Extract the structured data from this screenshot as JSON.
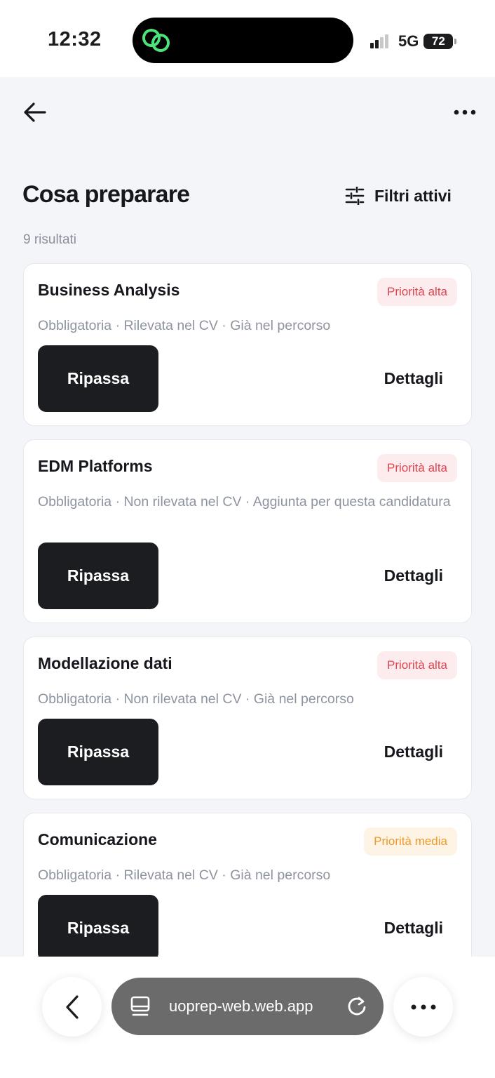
{
  "status_bar": {
    "time": "12:32",
    "network": "5G",
    "battery": "72"
  },
  "header": {
    "title": "Cosa preparare",
    "filters_label": "Filtri attivi",
    "result_count": "9 risultati"
  },
  "cards": [
    {
      "title": "Business Analysis",
      "priority": "Priorità alta",
      "meta": "Obbligatoria · Rilevata nel CV · Già nel percorso",
      "review_label": "Ripassa",
      "details_label": "Dettagli"
    },
    {
      "title": "EDM Platforms",
      "priority": "Priorità alta",
      "meta": "Obbligatoria · Non rilevata nel CV · Aggiunta per questa candidatura",
      "review_label": "Ripassa",
      "details_label": "Dettagli"
    },
    {
      "title": "Modellazione dati",
      "priority": "Priorità alta",
      "meta": "Obbligatoria · Non rilevata nel CV · Già nel percorso",
      "review_label": "Ripassa",
      "details_label": "Dettagli"
    },
    {
      "title": "Comunicazione",
      "priority": "Priorità media",
      "meta": "Obbligatoria · Rilevata nel CV · Già nel percorso",
      "review_label": "Ripassa",
      "details_label": "Dettagli"
    }
  ],
  "browser": {
    "url": "uoprep-web.web.app"
  },
  "colors": {
    "priority_high": "#e0444f",
    "priority_medium": "#ec9a2a",
    "button_dark": "#1c1d21",
    "page_background": "#f4f5f9"
  },
  "icons": [
    "back-arrow-icon",
    "more-icon",
    "filter-icon",
    "chevron-left-icon",
    "tabs-icon",
    "reload-icon",
    "app-logo-icon"
  ]
}
